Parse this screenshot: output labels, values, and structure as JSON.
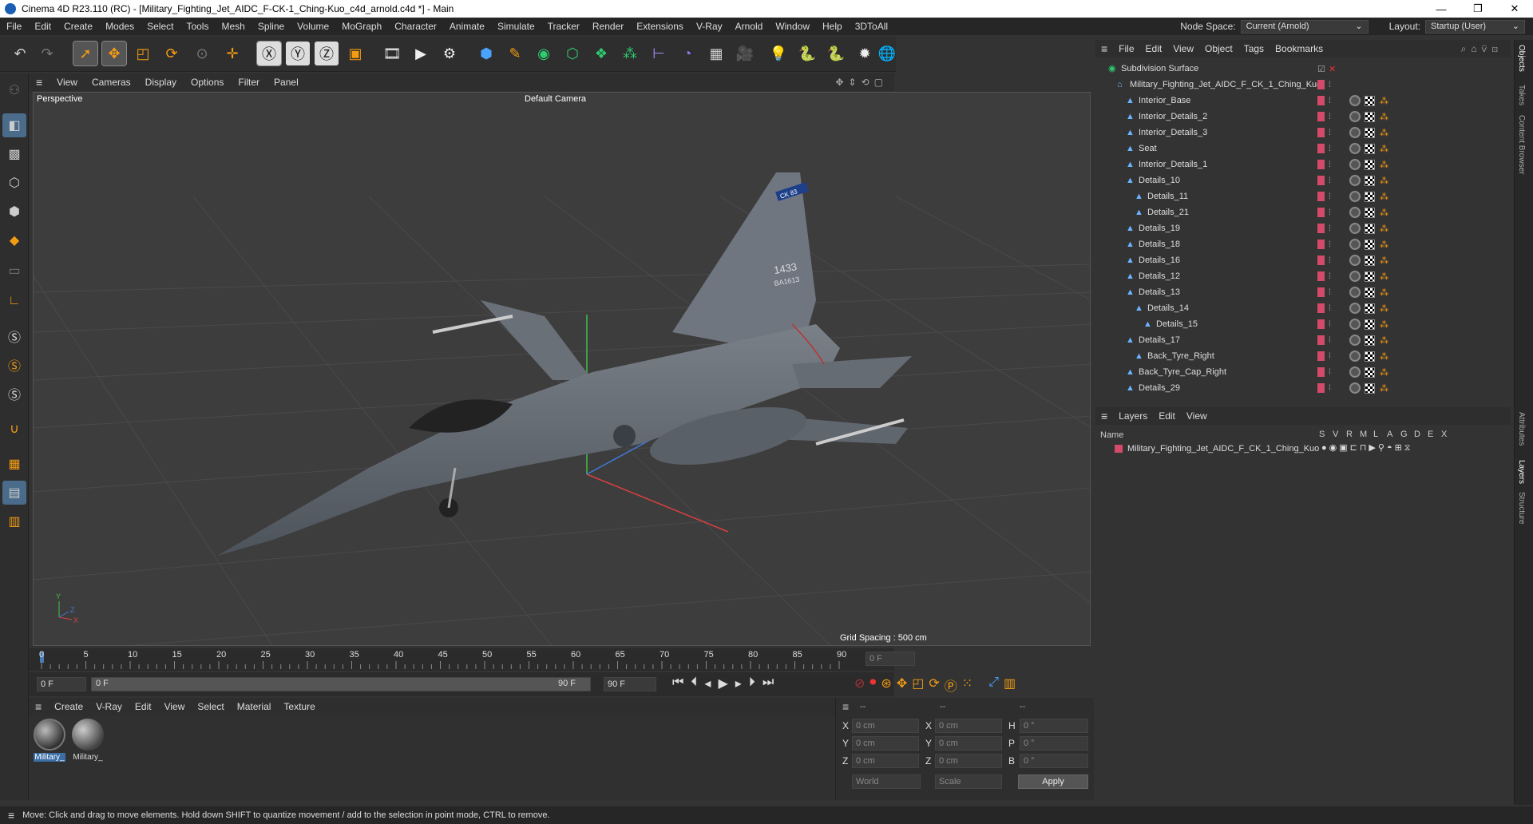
{
  "window": {
    "title": "Cinema 4D R23.110 (RC) - [Military_Fighting_Jet_AIDC_F-CK-1_Ching-Kuo_c4d_arnold.c4d *] - Main",
    "minimize": "—",
    "maximize": "❐",
    "close": "✕"
  },
  "menubar": {
    "items": [
      "File",
      "Edit",
      "Create",
      "Modes",
      "Select",
      "Tools",
      "Mesh",
      "Spline",
      "Volume",
      "MoGraph",
      "Character",
      "Animate",
      "Simulate",
      "Tracker",
      "Render",
      "Extensions",
      "V-Ray",
      "Arnold",
      "Window",
      "Help",
      "3DToAll"
    ],
    "node_space_label": "Node Space:",
    "node_space_value": "Current (Arnold)",
    "layout_label": "Layout:",
    "layout_value": "Startup (User)"
  },
  "viewport": {
    "menu": [
      "View",
      "Cameras",
      "Display",
      "Options",
      "Filter",
      "Panel"
    ],
    "label": "Perspective",
    "camera": "Default Camera",
    "grid_spacing": "Grid Spacing : 500 cm",
    "tail_text": "CK 83",
    "tail_number": "1433",
    "tail_serial": "BA1613"
  },
  "timeline": {
    "ticks": [
      "0",
      "5",
      "10",
      "15",
      "20",
      "25",
      "30",
      "35",
      "40",
      "45",
      "50",
      "55",
      "60",
      "65",
      "70",
      "75",
      "80",
      "85",
      "90"
    ],
    "current_frame": "0 F"
  },
  "transport": {
    "start": "0 F",
    "range_start": "0 F",
    "range_end": "90 F",
    "end": "90 F"
  },
  "material_manager": {
    "menu": [
      "Create",
      "V-Ray",
      "Edit",
      "View",
      "Select",
      "Material",
      "Texture"
    ],
    "materials": [
      "Military_",
      "Military_"
    ]
  },
  "coordinates": {
    "header": [
      "--",
      "--",
      "--"
    ],
    "rows": [
      {
        "a": "X",
        "av": "0 cm",
        "b": "X",
        "bv": "0 cm",
        "c": "H",
        "cv": "0 °"
      },
      {
        "a": "Y",
        "av": "0 cm",
        "b": "Y",
        "bv": "0 cm",
        "c": "P",
        "cv": "0 °"
      },
      {
        "a": "Z",
        "av": "0 cm",
        "b": "Z",
        "bv": "0 cm",
        "c": "B",
        "cv": "0 °"
      }
    ],
    "world": "World",
    "scale": "Scale",
    "apply": "Apply"
  },
  "object_manager": {
    "menu": [
      "File",
      "Edit",
      "View",
      "Object",
      "Tags",
      "Bookmarks"
    ],
    "objects": [
      {
        "name": "Subdivision Surface",
        "level": 0
      },
      {
        "name": "Military_Fighting_Jet_AIDC_F_CK_1_Ching_Kuo",
        "level": 1
      },
      {
        "name": "Interior_Base",
        "level": 2
      },
      {
        "name": "Interior_Details_2",
        "level": 2
      },
      {
        "name": "Interior_Details_3",
        "level": 2
      },
      {
        "name": "Seat",
        "level": 2
      },
      {
        "name": "Interior_Details_1",
        "level": 2
      },
      {
        "name": "Details_10",
        "level": 2
      },
      {
        "name": "Details_11",
        "level": 3
      },
      {
        "name": "Details_21",
        "level": 3
      },
      {
        "name": "Details_19",
        "level": 2
      },
      {
        "name": "Details_18",
        "level": 2
      },
      {
        "name": "Details_16",
        "level": 2
      },
      {
        "name": "Details_12",
        "level": 2
      },
      {
        "name": "Details_13",
        "level": 2
      },
      {
        "name": "Details_14",
        "level": 3
      },
      {
        "name": "Details_15",
        "level": 4
      },
      {
        "name": "Details_17",
        "level": 2
      },
      {
        "name": "Back_Tyre_Right",
        "level": 3
      },
      {
        "name": "Back_Tyre_Cap_Right",
        "level": 2
      },
      {
        "name": "Details_29",
        "level": 2
      }
    ]
  },
  "layers": {
    "menu": [
      "Layers",
      "Edit",
      "View"
    ],
    "header_name": "Name",
    "header_cols": [
      "S",
      "V",
      "R",
      "M",
      "L",
      "A",
      "G",
      "D",
      "E",
      "X"
    ],
    "items": [
      {
        "name": "Military_Fighting_Jet_AIDC_F_CK_1_Ching_Kuo",
        "color": "#d34a6a"
      }
    ]
  },
  "side_tabs": [
    "Objects",
    "Takes",
    "Content Browser",
    "Attributes",
    "Layers",
    "Structure"
  ],
  "status": "Move: Click and drag to move elements. Hold down SHIFT to quantize movement / add to the selection in point mode, CTRL to remove.",
  "colors": {
    "accent": "#f39c12",
    "layer": "#d34a6a",
    "axis_x": "#d94040",
    "axis_y": "#3fc24a",
    "axis_z": "#3f7ad9"
  },
  "icons": {
    "toolbar": [
      "undo-icon",
      "redo-icon",
      "select-icon",
      "move-icon",
      "scale-icon",
      "rotate-icon",
      "live-select-icon",
      "transform-icon",
      "x-axis-icon",
      "y-axis-icon",
      "z-axis-icon",
      "coord-system-icon",
      "render-view-icon",
      "render-icon",
      "render-settings-icon",
      "cube-icon",
      "pen-icon",
      "subdivision-icon",
      "extrude-icon",
      "cloner-icon",
      "mograph-icon",
      "deformer-icon",
      "field-icon",
      "floor-icon",
      "camera-icon",
      "light-icon",
      "python-icon",
      "python2-icon",
      "gear-icon",
      "globe-icon"
    ],
    "left": [
      "model-mode-icon",
      "object-mode-icon",
      "texture-mode-icon",
      "points-mode-icon",
      "edges-mode-icon",
      "polygons-mode-icon",
      "axis-icon",
      "snap-s-icon",
      "snap-s2-icon",
      "snap-s3-icon",
      "magnet-icon",
      "grid-icon",
      "workplane-icon",
      "lock-icon"
    ]
  }
}
